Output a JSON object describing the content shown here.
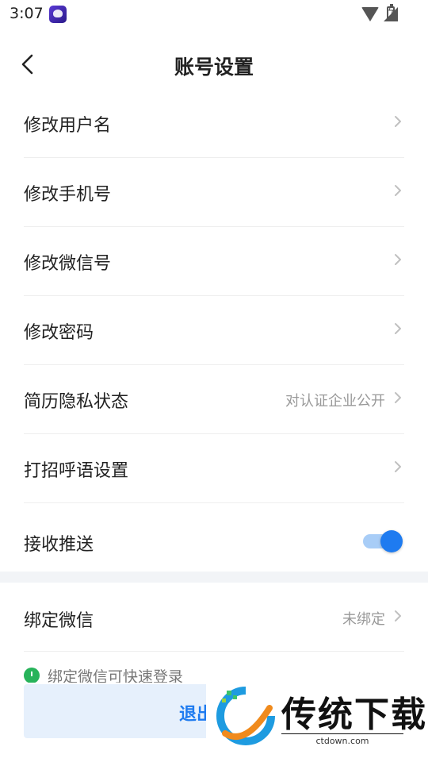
{
  "status_bar": {
    "time": "3:07"
  },
  "header": {
    "title": "账号设置"
  },
  "settings": {
    "items": [
      {
        "label": "修改用户名",
        "value": ""
      },
      {
        "label": "修改手机号",
        "value": ""
      },
      {
        "label": "修改微信号",
        "value": ""
      },
      {
        "label": "修改密码",
        "value": ""
      },
      {
        "label": "简历隐私状态",
        "value": "对认证企业公开"
      },
      {
        "label": "打招呼语设置",
        "value": ""
      }
    ],
    "push": {
      "label": "接收推送",
      "enabled": true
    }
  },
  "wechat": {
    "label": "绑定微信",
    "value": "未绑定",
    "hint": "绑定微信可快速登录"
  },
  "logout": {
    "label": "退出登录"
  },
  "watermark": {
    "brand": "传统下载",
    "site": "ctdown.com"
  },
  "colors": {
    "accent": "#1e7bf0",
    "toggle_track": "#a8cdf7",
    "hint_icon": "#27b35a",
    "divider": "#eeeeee",
    "section_gap": "#f2f4f7"
  }
}
